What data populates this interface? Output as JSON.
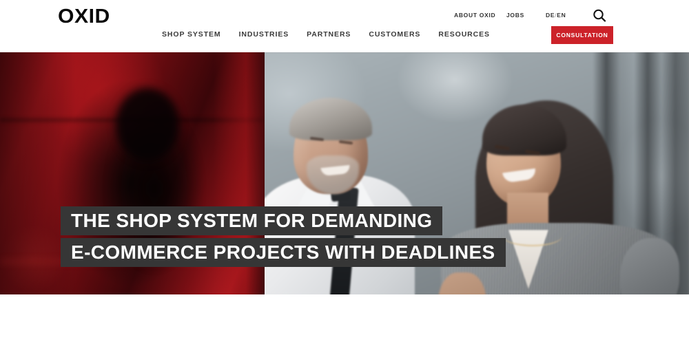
{
  "brand": {
    "logo_text": "OXID",
    "accent_color": "#cc2229",
    "headline_block_color": "#363636"
  },
  "header": {
    "utility_nav": [
      {
        "label": "ABOUT OXID",
        "name": "about-oxid"
      },
      {
        "label": "JOBS",
        "name": "jobs"
      }
    ],
    "language": {
      "primary": "DE",
      "separator": "/",
      "secondary": "EN"
    },
    "search": {
      "icon": "search-icon",
      "aria_label": "Search"
    },
    "main_nav": [
      {
        "label": "SHOP SYSTEM"
      },
      {
        "label": "INDUSTRIES"
      },
      {
        "label": "PARTNERS"
      },
      {
        "label": "CUSTOMERS"
      },
      {
        "label": "RESOURCES"
      }
    ],
    "cta": {
      "label": "CONSULTATION"
    }
  },
  "hero": {
    "headline_lines": [
      "THE SHOP SYSTEM FOR DEMANDING",
      "E-COMMERCE PROJECTS WITH DEADLINES"
    ],
    "image_description": "Smiling businessman in white shirt and dark tie beside a smiling woman in a grey pleated blouse, both looking at a laptop in a modern office; the left third is a red-tinted blurred overlay panel"
  }
}
